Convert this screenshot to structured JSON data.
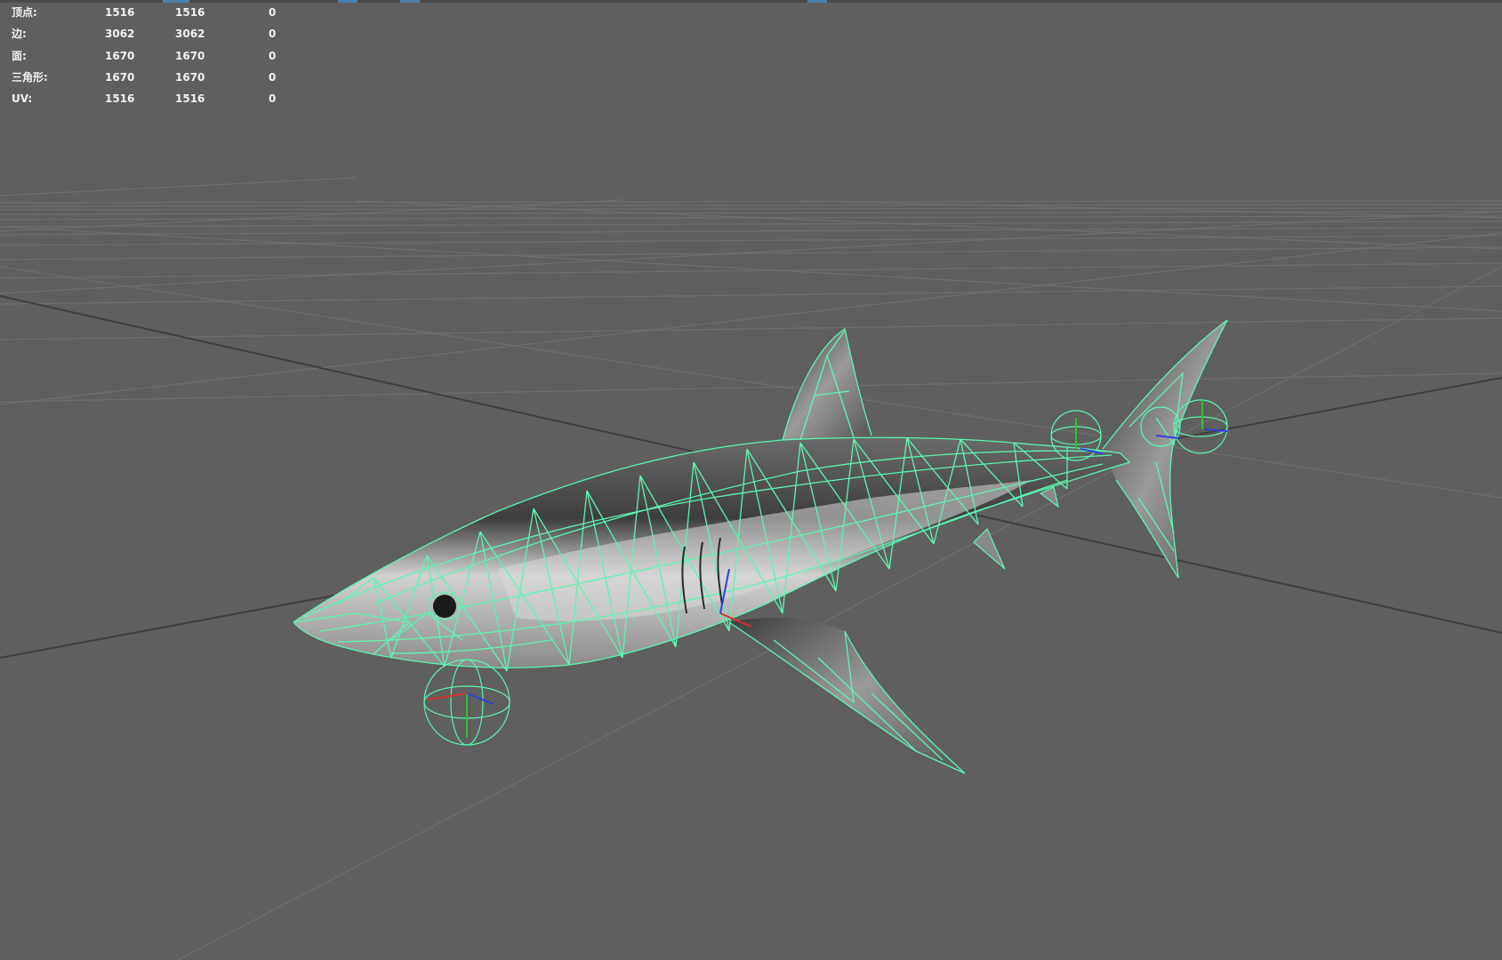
{
  "heads_up_display": {
    "rows": [
      {
        "label": "顶点:",
        "col1": "1516",
        "col2": "1516",
        "col3": "0"
      },
      {
        "label": "边:",
        "col1": "3062",
        "col2": "3062",
        "col3": "0"
      },
      {
        "label": "面:",
        "col1": "1670",
        "col2": "1670",
        "col3": "0"
      },
      {
        "label": "三角形:",
        "col1": "1670",
        "col2": "1670",
        "col3": "0"
      },
      {
        "label": "UV:",
        "col1": "1516",
        "col2": "1516",
        "col3": "0"
      }
    ]
  },
  "colors": {
    "viewport_background": "#5f5f5f",
    "grid_line": "#6e6e6e",
    "grid_axis": "#3d3d3d",
    "wireframe": "#5df5b0",
    "model_shade_light": "#c9c9c9",
    "model_shade_dark": "#4a4a4a",
    "axis_x": "#d83030",
    "axis_y": "#30c030",
    "axis_z": "#3040e0"
  },
  "icons": {
    "model": "shark-model-icon",
    "joint": "joint-sphere-icon"
  }
}
